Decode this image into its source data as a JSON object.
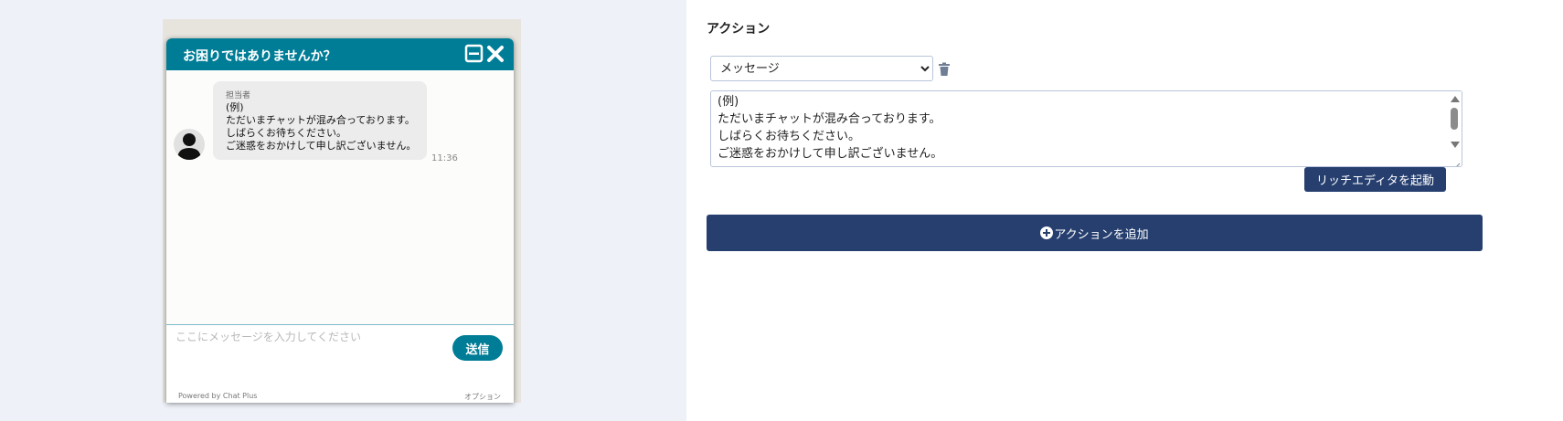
{
  "chat_preview": {
    "header_title": "お困りではありませんか？",
    "message": {
      "sender": "担当者",
      "lines": [
        "(例)",
        "ただいまチャットが混み合っております。",
        "しばらくお待ちください。",
        "ご迷惑をおかけして申し訳ございません。"
      ],
      "time": "11:36"
    },
    "input_placeholder": "ここにメッセージを入力してください",
    "send_label": "送信",
    "powered_by": "Powered by Chat Plus",
    "options_label": "オプション",
    "brand_color": "#007d96",
    "icons": [
      "minimize-icon",
      "close-icon",
      "user-avatar-icon"
    ]
  },
  "action_panel": {
    "title": "アクション",
    "select": {
      "selected": "メッセージ"
    },
    "message_text": "(例)\nただいまチャットが混み合っております。\nしばらくお待ちください。\nご迷惑をおかけして申し訳ございません。",
    "rich_editor_label": "リッチエディタを起動",
    "add_action_label": "アクションを追加",
    "button_color": "#263f6f",
    "icons": [
      "trash-icon",
      "plus-circle-icon"
    ]
  }
}
